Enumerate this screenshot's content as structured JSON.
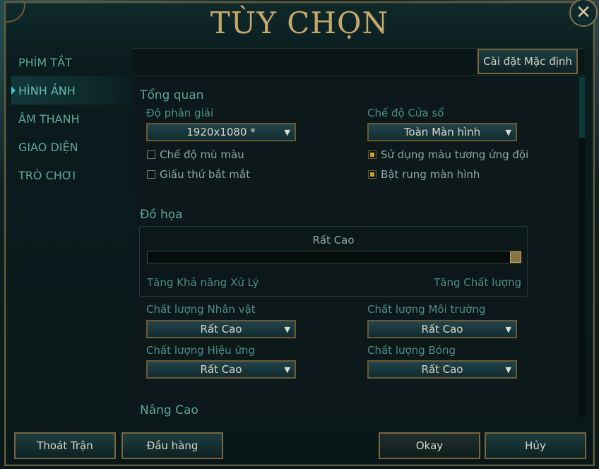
{
  "window": {
    "title": "TÙY CHỌN",
    "close_icon": "✕"
  },
  "sidebar": {
    "items": [
      {
        "label": "PHÍM TẮT"
      },
      {
        "label": "HÌNH ẢNH",
        "active": true
      },
      {
        "label": "ÂM THANH"
      },
      {
        "label": "GIAO DIỆN"
      },
      {
        "label": "TRÒ CHƠI"
      }
    ]
  },
  "toolbar": {
    "default_label": "Cài đặt Mặc định"
  },
  "overview": {
    "title": "Tổng quan",
    "resolution_label": "Độ phân giải",
    "resolution_value": "1920x1080 *",
    "window_mode_label": "Chế độ Cửa sổ",
    "window_mode_value": "Toàn Màn hình",
    "colorblind_label": "Chế độ mù màu",
    "colorblind_checked": false,
    "hide_eyecandy_label": "Giấu thứ bắt mắt",
    "hide_eyecandy_checked": false,
    "team_colors_label": "Sử dụng màu tương ứng đội",
    "team_colors_checked": true,
    "screen_shake_label": "Bật rung màn hình",
    "screen_shake_checked": true
  },
  "graphics": {
    "title": "Đồ họa",
    "level_label": "Rất Cao",
    "slider_level": 1.0,
    "left_hint": "Tăng Khả năng Xử Lý",
    "right_hint": "Tăng Chất lượng",
    "character_label": "Chất lượng Nhân vật",
    "character_value": "Rất Cao",
    "environment_label": "Chất lượng Môi trường",
    "environment_value": "Rất Cao",
    "effects_label": "Chất lượng Hiệu ứng",
    "effects_value": "Rất Cao",
    "shadows_label": "Chất lượng Bóng",
    "shadows_value": "Rất Cao"
  },
  "advanced": {
    "title": "Nâng Cao"
  },
  "footer": {
    "exit_label": "Thoát Trận",
    "surrender_label": "Đầu hàng",
    "okay_label": "Okay",
    "cancel_label": "Hủy"
  },
  "colors": {
    "accent": "#5fa69a",
    "gold": "#c7a86a",
    "checkbox_on": "#c8a030"
  },
  "icons": {
    "dropdown": "▼",
    "close": "close-icon"
  }
}
